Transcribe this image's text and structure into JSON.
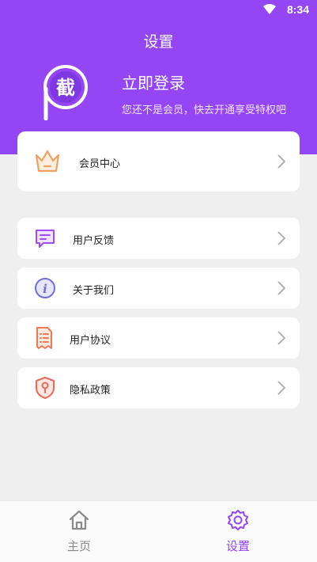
{
  "status_bar": {
    "time": "8:34"
  },
  "header": {
    "title": "设置",
    "login_title": "立即登录",
    "login_subtitle": "您还不是会员，快去开通享受特权吧",
    "logo_char": "截"
  },
  "vip": {
    "label": "会员中心",
    "icon": "crown-icon"
  },
  "menu": [
    {
      "label": "用户反馈",
      "icon": "feedback-icon"
    },
    {
      "label": "关于我们",
      "icon": "info-icon"
    },
    {
      "label": "用户协议",
      "icon": "document-icon"
    },
    {
      "label": "隐私政策",
      "icon": "shield-icon"
    }
  ],
  "tabbar": {
    "home": {
      "label": "主页",
      "icon": "home-icon",
      "color": "#8a8a8a"
    },
    "settings": {
      "label": "设置",
      "icon": "gear-icon",
      "color": "#9446f5"
    }
  },
  "colors": {
    "brand": "#9446f5",
    "background": "#efefef"
  }
}
